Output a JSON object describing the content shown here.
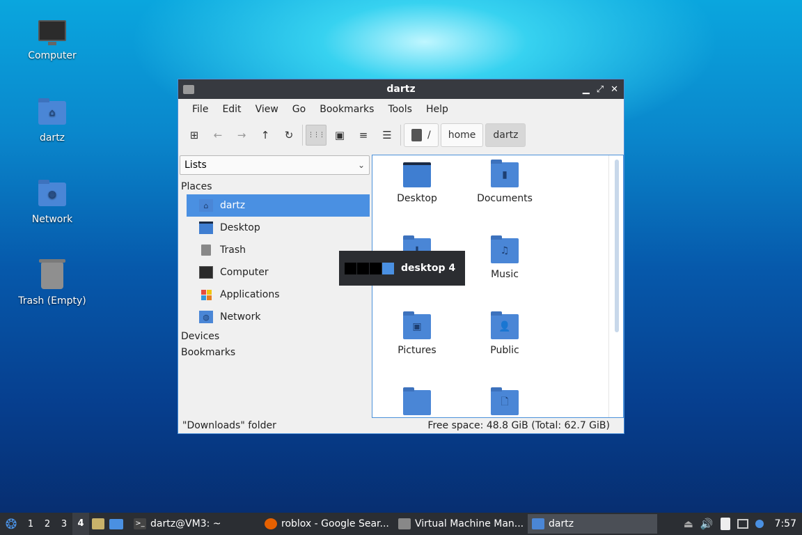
{
  "desktop": {
    "icons": [
      {
        "label": "Computer",
        "icon": "computer-icon"
      },
      {
        "label": "dartz",
        "icon": "home-folder-icon"
      },
      {
        "label": "Network",
        "icon": "network-folder-icon"
      },
      {
        "label": "Trash (Empty)",
        "icon": "trash-icon"
      }
    ]
  },
  "window": {
    "title": "dartz",
    "controls": {
      "minimize": "▁",
      "maximize": "⤢",
      "close": "✕"
    },
    "menu": [
      "File",
      "Edit",
      "View",
      "Go",
      "Bookmarks",
      "Tools",
      "Help"
    ],
    "toolbar": {
      "icons": [
        "new-tab-icon",
        "back-icon",
        "forward-icon",
        "up-icon",
        "reload-icon",
        "icon-view-icon",
        "thumbnail-view-icon",
        "compact-view-icon",
        "detailed-list-icon"
      ],
      "glyphs": {
        "new_tab": "⊞",
        "back": "←",
        "forward": "→",
        "up": "↑",
        "reload": "↻",
        "icon_view": "⋮⋮⋮",
        "thumbnail": "▣",
        "compact": "≡",
        "detailed": "☰"
      }
    },
    "breadcrumbs": [
      "/",
      "home",
      "dartz"
    ],
    "sidepane": {
      "mode": "Lists",
      "sections": {
        "places": "Places",
        "devices": "Devices",
        "bookmarks": "Bookmarks"
      },
      "places": [
        {
          "label": "dartz",
          "selected": true
        },
        {
          "label": "Desktop"
        },
        {
          "label": "Trash"
        },
        {
          "label": "Computer"
        },
        {
          "label": "Applications"
        },
        {
          "label": "Network"
        }
      ]
    },
    "files": [
      {
        "name": "Desktop"
      },
      {
        "name": "Documents",
        "glyph": "▮"
      },
      {
        "name": "",
        "glyph": "⬇"
      },
      {
        "name": "Music",
        "glyph": "♫"
      },
      {
        "name": "Pictures",
        "glyph": "▣"
      },
      {
        "name": "Public",
        "glyph": "👤"
      },
      {
        "name": "",
        "glyph": ""
      },
      {
        "name": "",
        "glyph": "🗋"
      }
    ],
    "status": {
      "left": "\"Downloads\" folder",
      "right": "Free space: 48.8 GiB (Total: 62.7 GiB)"
    }
  },
  "workspace_popup": {
    "label": "desktop 4",
    "workspaces": 4,
    "current": 4
  },
  "taskbar": {
    "workspaces": [
      "1",
      "2",
      "3",
      "4"
    ],
    "current_workspace": "4",
    "tasks": [
      {
        "label": "dartz@VM3: ~",
        "icon": "terminal-icon",
        "color": "#444444"
      },
      {
        "label": "roblox - Google Sear...",
        "icon": "firefox-icon",
        "color": "#e66000"
      },
      {
        "label": "Virtual Machine Man...",
        "icon": "virt-manager-icon",
        "color": "#888888"
      },
      {
        "label": "dartz",
        "icon": "folder-icon",
        "color": "#4a86d6",
        "active": true
      }
    ],
    "clock": "7:57"
  },
  "colors": {
    "accent": "#4a90e2",
    "titlebar": "#373a40",
    "taskbar": "#2b2e33"
  }
}
